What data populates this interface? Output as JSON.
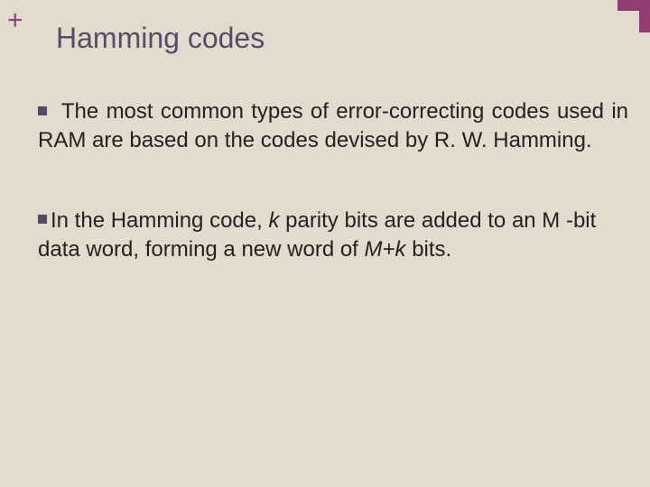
{
  "decor": {
    "plus": "+"
  },
  "title": "Hamming codes",
  "bullets": {
    "b1": {
      "text": "The most common types of error-correcting codes used in RAM are based on the codes devised by R. W. Hamming."
    },
    "b2": {
      "prefix": "In the Hamming code, ",
      "k1": "k",
      "mid1": " parity bits are added to an M -bit data word, forming a new word of ",
      "mk": "M+k",
      "suffix": " bits."
    }
  }
}
